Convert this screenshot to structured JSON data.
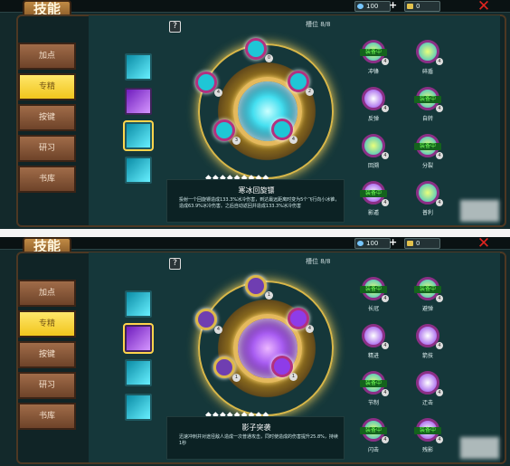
{
  "common": {
    "title": "技能",
    "diamond_count": "100",
    "plus_sign": "+",
    "bag_count": "0",
    "close_symbol": "✕",
    "help_symbol": "?",
    "slot_text": "槽位 8/8",
    "dot_text": "◆◆◆◆◆◆◆◆◆"
  },
  "sidebar": {
    "items": [
      "加点",
      "专精",
      "按键",
      "研习",
      "书库"
    ]
  },
  "panels": [
    {
      "selected_skill_name": "寒冰回旋镖",
      "selected_skill_description": "投射一个回旋镖造成133.3%冰冷伤害，到达最远距离时变为5个飞行向小冰锥，造成63.9%冰冷伤害。之后自动返回并造成133.3%冰冷伤害",
      "center_orb_type": "cyan",
      "orb_levels": [
        "0",
        "4",
        "2",
        "3",
        "4"
      ],
      "right_skills": [
        {
          "label": "冲锋",
          "equipped": true,
          "equipped_label": "装备中",
          "level": "4"
        },
        {
          "label": "碎盾",
          "equipped": false,
          "equipped_label": "",
          "level": "4"
        },
        {
          "label": "反弹",
          "equipped": false,
          "equipped_label": "",
          "level": "4"
        },
        {
          "label": "自转",
          "equipped": true,
          "equipped_label": "装备中",
          "level": "4"
        },
        {
          "label": "回溯",
          "equipped": false,
          "equipped_label": "",
          "level": "4"
        },
        {
          "label": "分裂",
          "equipped": true,
          "equipped_label": "装备中",
          "level": "4"
        },
        {
          "label": "影遁",
          "equipped": true,
          "equipped_label": "装备中",
          "level": "4"
        },
        {
          "label": "普利",
          "equipped": false,
          "equipped_label": "",
          "level": "4"
        }
      ]
    },
    {
      "selected_skill_name": "影子突袭",
      "selected_skill_description": "迅速冲刺并对途径敌人造成一次普通攻击，同时使造成的伤害提升25.8%，持续1秒",
      "center_orb_type": "purple",
      "orb_levels": [
        "1",
        "4",
        "4",
        "1",
        "1"
      ],
      "right_skills": [
        {
          "label": "长冠",
          "equipped": true,
          "equipped_label": "装备中",
          "level": "4"
        },
        {
          "label": "避弹",
          "equipped": true,
          "equipped_label": "装备中",
          "level": "4"
        },
        {
          "label": "精进",
          "equipped": false,
          "equipped_label": "",
          "level": "4"
        },
        {
          "label": "箭技",
          "equipped": false,
          "equipped_label": "",
          "level": "4"
        },
        {
          "label": "节制",
          "equipped": true,
          "equipped_label": "装备中",
          "level": "4"
        },
        {
          "label": "迂击",
          "equipped": false,
          "equipped_label": "",
          "level": "4"
        },
        {
          "label": "闪击",
          "equipped": true,
          "equipped_label": "装备中",
          "level": "4"
        },
        {
          "label": "残影",
          "equipped": true,
          "equipped_label": "装备中",
          "level": "4"
        }
      ]
    }
  ],
  "colors": {
    "accent_gold": "#ffd44c",
    "equipped_green": "#6dff52",
    "close_red": "#e0241f"
  }
}
